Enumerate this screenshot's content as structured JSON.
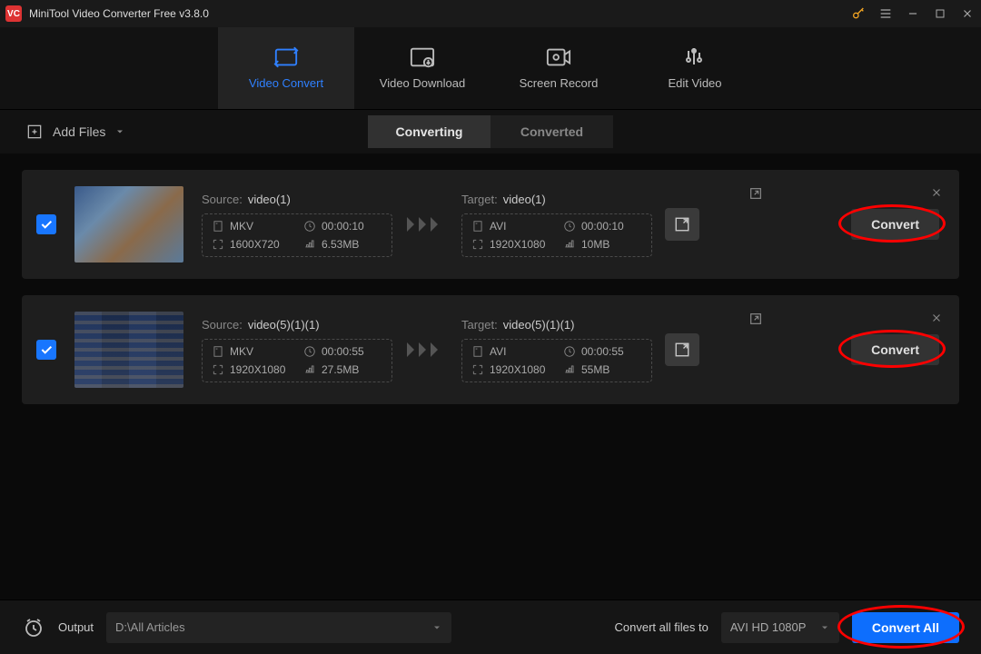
{
  "app": {
    "title": "MiniTool Video Converter Free v3.8.0"
  },
  "tabs": {
    "video_convert": "Video Convert",
    "video_download": "Video Download",
    "screen_record": "Screen Record",
    "edit_video": "Edit Video"
  },
  "toolbar": {
    "add_files": "Add Files",
    "converting": "Converting",
    "converted": "Converted"
  },
  "labels": {
    "source": "Source:",
    "target": "Target:",
    "convert": "Convert",
    "output": "Output",
    "convert_all_to": "Convert all files to",
    "convert_all": "Convert All"
  },
  "files": [
    {
      "source_name": "video(1)",
      "source_format": "MKV",
      "source_duration": "00:00:10",
      "source_res": "1600X720",
      "source_size": "6.53MB",
      "target_name": "video(1)",
      "target_format": "AVI",
      "target_duration": "00:00:10",
      "target_res": "1920X1080",
      "target_size": "10MB"
    },
    {
      "source_name": "video(5)(1)(1)",
      "source_format": "MKV",
      "source_duration": "00:00:55",
      "source_res": "1920X1080",
      "source_size": "27.5MB",
      "target_name": "video(5)(1)(1)",
      "target_format": "AVI",
      "target_duration": "00:00:55",
      "target_res": "1920X1080",
      "target_size": "55MB"
    }
  ],
  "footer": {
    "output_path": "D:\\All Articles",
    "target_format": "AVI HD 1080P"
  }
}
